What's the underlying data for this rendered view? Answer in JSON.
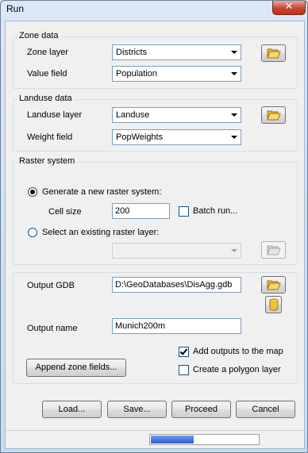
{
  "window": {
    "title": "Run",
    "close_glyph": "✕"
  },
  "zone": {
    "legend": "Zone data",
    "layer_label": "Zone layer",
    "layer_value": "Districts",
    "value_label": "Value field",
    "value_value": "Population",
    "browse_icon": "open-folder-icon"
  },
  "landuse": {
    "legend": "Landuse data",
    "layer_label": "Landuse layer",
    "layer_value": "Landuse",
    "weight_label": "Weight field",
    "weight_value": "PopWeights",
    "browse_icon": "open-folder-icon"
  },
  "raster": {
    "legend": "Raster system",
    "generate_label": "Generate a new raster system:",
    "generate_selected": true,
    "cellsize_label": "Cell size",
    "cellsize_value": "200",
    "batch_label": "Batch run...",
    "batch_checked": false,
    "existing_label": "Select an existing raster layer:",
    "existing_selected": false,
    "existing_value": ""
  },
  "output": {
    "gdb_label": "Output GDB",
    "gdb_value": "D:\\GeoDatabases\\DisAgg.gdb",
    "name_label": "Output name",
    "name_value": "Munich200m",
    "append_label": "Append zone fields...",
    "add_outputs_label": "Add outputs to the map",
    "add_outputs_checked": true,
    "polygon_label": "Create a polygon layer",
    "polygon_checked": false
  },
  "buttons": {
    "load": "Load...",
    "save": "Save...",
    "proceed": "Proceed",
    "cancel": "Cancel"
  },
  "status": {
    "progress": 0.4
  },
  "colors": {
    "close": "#c9452f",
    "progress": "#2a5fd0",
    "folder": "#f1c232"
  }
}
